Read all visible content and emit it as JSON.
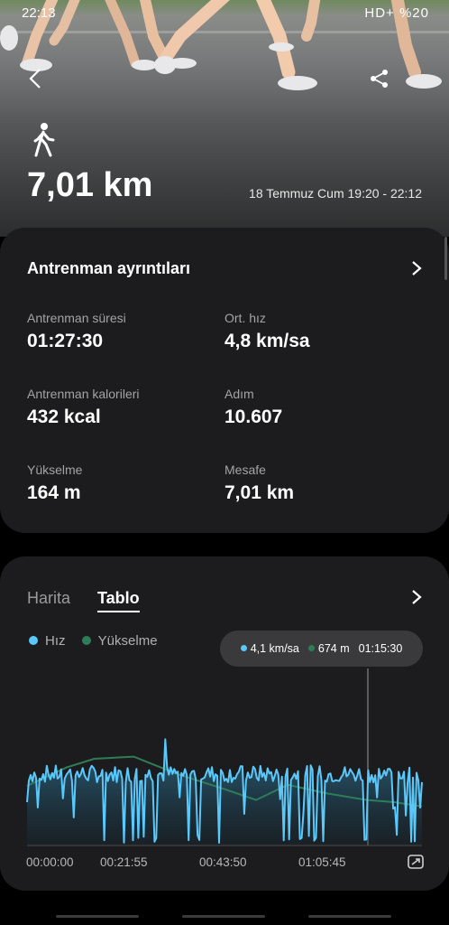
{
  "status_bar": {
    "time": "22:13",
    "right": "HD+ %20"
  },
  "hero": {
    "distance": "7,01 km",
    "date_time": "18 Temmuz Cum 19:20 - 22:12"
  },
  "details_card": {
    "title": "Antrenman ayrıntıları",
    "stats": [
      {
        "label": "Antrenman süresi",
        "value": "01:27:30"
      },
      {
        "label": "Ort. hız",
        "value": "4,8 km/sa"
      },
      {
        "label": "Antrenman kalorileri",
        "value": "432 kcal"
      },
      {
        "label": "Adım",
        "value": "10.607"
      },
      {
        "label": "Yükselme",
        "value": "164 m"
      },
      {
        "label": "Mesafe",
        "value": "7,01 km"
      }
    ]
  },
  "chart_card": {
    "tabs": [
      {
        "label": "Harita",
        "active": false
      },
      {
        "label": "Tablo",
        "active": true
      }
    ],
    "legend": [
      {
        "label": "Hız",
        "color": "#5ac8fa"
      },
      {
        "label": "Yükselme",
        "color": "#2e7d58"
      }
    ],
    "tooltip": {
      "speed": "4,1 km/sa",
      "elevation": "674 m",
      "time": "01:15:30"
    }
  },
  "chart_data": {
    "type": "line",
    "x_labels": [
      "00:00:00",
      "00:21:55",
      "00:43:50",
      "01:05:45"
    ],
    "series": [
      {
        "name": "Hız",
        "color": "#5ac8fa"
      },
      {
        "name": "Yükselme",
        "color": "#2e7d58"
      }
    ]
  }
}
